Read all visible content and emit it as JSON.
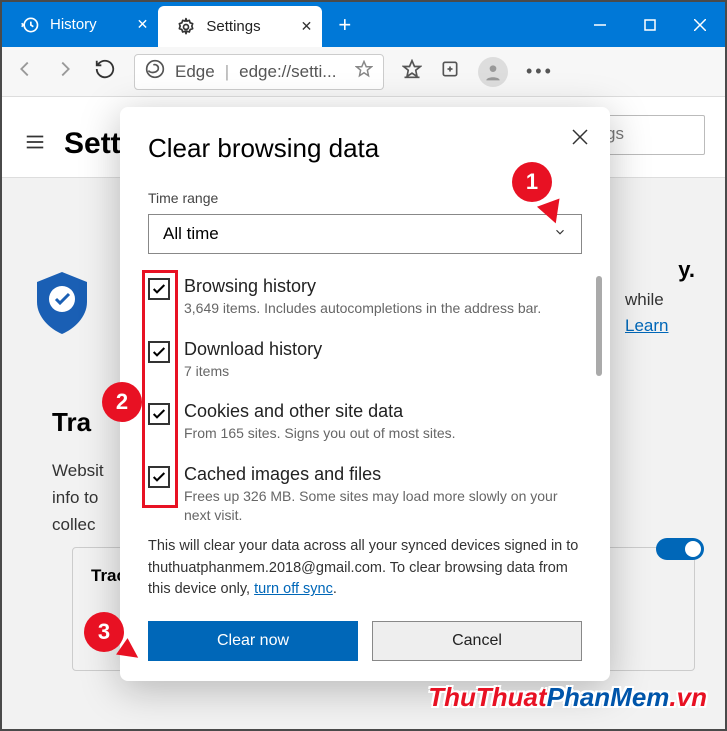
{
  "tabs": [
    {
      "label": "History",
      "icon": "history-icon"
    },
    {
      "label": "Settings",
      "icon": "gear-icon"
    }
  ],
  "address": {
    "appLabel": "Edge",
    "url": "edge://setti..."
  },
  "page": {
    "title": "Settings",
    "search_placeholder": "gs",
    "privacy_heading_suffix": "y.",
    "privacy_line1": "while",
    "learn": "Learn",
    "track_title": "Tra",
    "track_text": "Websit... ...y use this info to ... ...e trackers collect...",
    "panel_label": "Trac"
  },
  "modal": {
    "title": "Clear browsing data",
    "time_label": "Time range",
    "time_value": "All time",
    "options": [
      {
        "title": "Browsing history",
        "sub": "3,649 items. Includes autocompletions in the address bar.",
        "checked": true
      },
      {
        "title": "Download history",
        "sub": "7 items",
        "checked": true
      },
      {
        "title": "Cookies and other site data",
        "sub": "From 165 sites. Signs you out of most sites.",
        "checked": true
      },
      {
        "title": "Cached images and files",
        "sub": "Frees up 326 MB. Some sites may load more slowly on your next visit.",
        "checked": true
      }
    ],
    "note_1": "This will clear your data across all your synced devices signed in to thuthuatphanmem.2018@gmail.com. To clear browsing data from this device only, ",
    "note_link": "turn off sync",
    "note_2": ".",
    "clear": "Clear now",
    "cancel": "Cancel"
  },
  "annotations": {
    "1": "1",
    "2": "2",
    "3": "3"
  },
  "watermark": {
    "a": "ThuThuat",
    "b": "PhanMem",
    "c": ".vn"
  }
}
